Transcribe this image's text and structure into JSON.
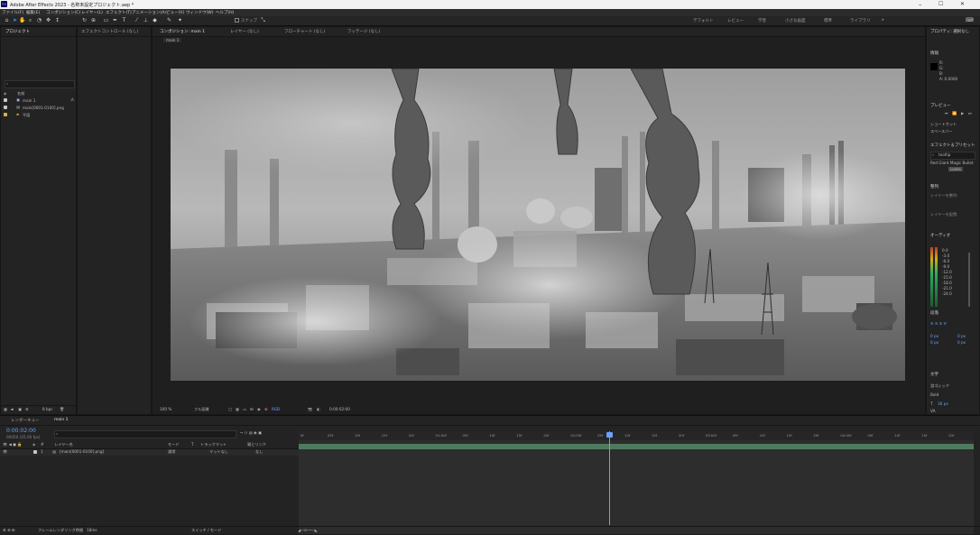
{
  "window": {
    "title": "Adobe After Effects 2023 - 名称未設定プロジェクト.aep *",
    "app_icon": "Ae",
    "controls": [
      "–",
      "☐",
      "✕"
    ]
  },
  "menu": [
    "ファイル(F)",
    "編集(E)",
    "コンポジション(C)",
    "レイヤー(L)",
    "エフェクト(T)",
    "アニメーション(A)",
    "ビュー(V)",
    "ウィンドウ(W)",
    "ヘルプ(H)"
  ],
  "toolbar": {
    "snap_label": "スナップ",
    "workspaces": [
      "デフォルト",
      "レビュー",
      "学習",
      "小さな画面",
      "標準",
      "ライブラリ"
    ],
    "more": "»"
  },
  "project": {
    "tab": "プロジェクト",
    "search_placeholder": "",
    "column_name": "名前",
    "items": [
      {
        "name": "main 1",
        "color": "#c8c8c8"
      },
      {
        "name": "main[0001-0100].png",
        "color": "#c8c8c8"
      },
      {
        "name": "平面",
        "color": "#d8b340"
      }
    ],
    "footer_bpc": "8 bpc"
  },
  "effect_controls": {
    "tab": "エフェクトコントロール (なし)"
  },
  "viewer": {
    "tabs": [
      {
        "label": "コンポジション: main 1",
        "active": true
      },
      {
        "label": "レイヤー (なし)",
        "active": false
      },
      {
        "label": "フローチャート (なし)",
        "active": false
      },
      {
        "label": "フッテージ (なし)",
        "active": false
      }
    ],
    "breadcrumb": "main 1",
    "zoom": "100 %",
    "resolution": "フル画質",
    "channel": "RGB",
    "timecode": "0:00:02:00"
  },
  "right_panel": {
    "properties_tab": "プロパティ: 選択なし",
    "info_tab": "情報",
    "info_values": [
      "R:",
      "G:",
      "B:",
      "A: 0.0000"
    ],
    "preview_tab": "プレビュー",
    "shortcut_label": "ショートカット",
    "shortcut_value": "スペースバー",
    "effects_tab": "エフェクト＆プリセット",
    "effects_search": "tooltip",
    "effects_tree": [
      "Red Giant Magic Bullet",
      "Looks"
    ],
    "align_tab": "整列",
    "align_to": "レイヤーを整列:",
    "distribute": "レイヤーを配置:",
    "audio_tab": "オーディオ",
    "audio_db": [
      "0.0",
      "-3.0",
      "-6.0",
      "-9.0",
      "-12.0",
      "-15.0",
      "-18.0",
      "-21.0",
      "-24.0"
    ],
    "paragraph_tab": "段落",
    "paragraph_values": [
      "0 px",
      "0 px",
      "0 px",
      "0 px",
      "0 px"
    ],
    "char_tab": "文字",
    "font": "游ゴシック",
    "font_style": "Bold",
    "font_size": "36 px",
    "metrics": "VA"
  },
  "timeline": {
    "tabs": [
      "レンダーキュー",
      "main 1"
    ],
    "timecode": "0:00:02:00",
    "timecode_sub": "00050 (25.00 fps)",
    "columns": [
      "レイヤー名",
      "モード",
      "T",
      "トラックマット",
      "親とリンク"
    ],
    "layers": [
      {
        "num": "1",
        "name": "[main[0001-0100].png]",
        "mode": "通常",
        "matte": "マットなし",
        "parent": "なし"
      }
    ],
    "ruler_labels": [
      "0f",
      "05f",
      "10f",
      "15f",
      "20f",
      "01:00f",
      "05f",
      "10f",
      "15f",
      "20f",
      "02:00f",
      "05f",
      "10f",
      "15f",
      "20f",
      "03:00f",
      "05f",
      "10f",
      "15f",
      "20f",
      "04:00f",
      "05f",
      "10f",
      "15f",
      "20f"
    ],
    "footer_render": "フレームレンダリング時間",
    "footer_render_value": "18ms",
    "footer_toggle": "スイッチ / モード"
  }
}
